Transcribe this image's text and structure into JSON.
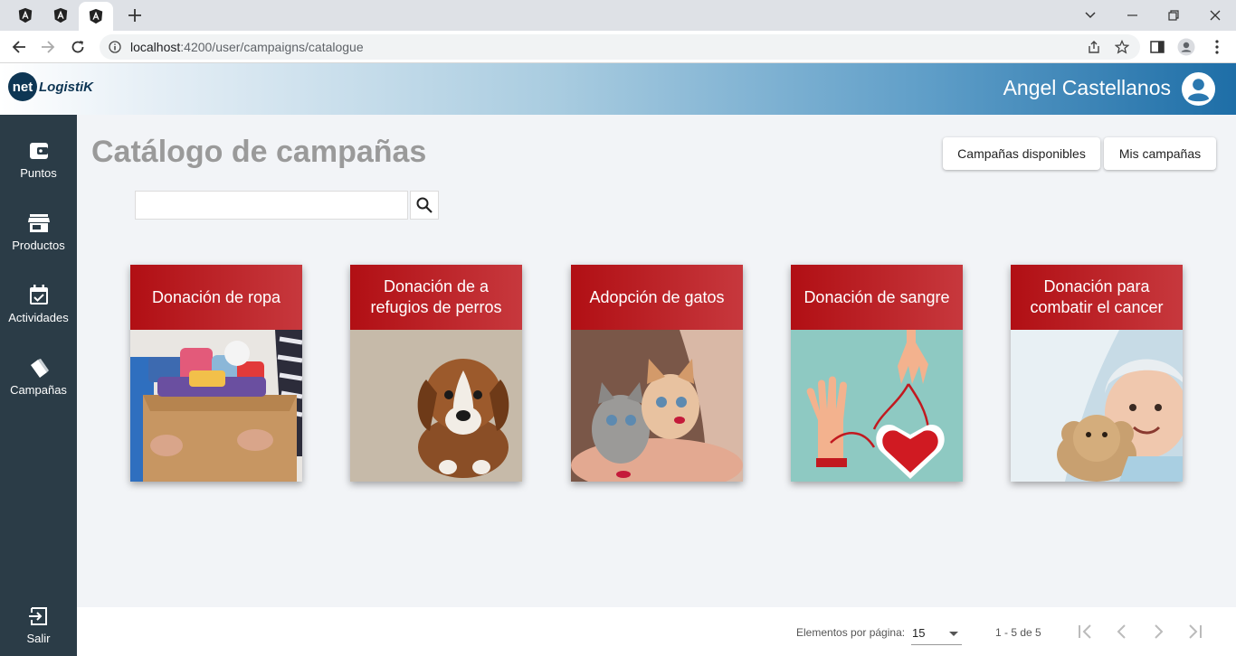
{
  "browser": {
    "url_host": "localhost",
    "url_path": ":4200/user/campaigns/catalogue"
  },
  "app": {
    "logo_badge": "net",
    "logo_text": "LogistiK",
    "user_name": "Angel Castellanos"
  },
  "sidebar": {
    "items": [
      {
        "label": "Puntos",
        "icon": "wallet-icon"
      },
      {
        "label": "Productos",
        "icon": "store-icon"
      },
      {
        "label": "Actividades",
        "icon": "calendar-check-icon"
      },
      {
        "label": "Campañas",
        "icon": "campaign-tag-icon"
      }
    ],
    "logout_label": "Salir"
  },
  "main": {
    "title": "Catálogo de campañas",
    "buttons": {
      "available": "Campañas disponibles",
      "mine": "Mis campañas"
    },
    "search": {
      "value": "",
      "placeholder": ""
    },
    "cards": [
      {
        "title": "Donación de ropa",
        "image": "clothes-box"
      },
      {
        "title": "Donación de a refugios de perros",
        "image": "puppy"
      },
      {
        "title": "Adopción de gatos",
        "image": "kittens"
      },
      {
        "title": "Donación de sangre",
        "image": "blood-heart"
      },
      {
        "title": "Donación para combatir el cancer",
        "image": "child-teddy"
      }
    ]
  },
  "paginator": {
    "items_per_page_label": "Elementos por página:",
    "items_per_page_value": "15",
    "range_label": "1 - 5 de 5"
  },
  "colors": {
    "sidebar": "#2b3c47",
    "card_header": "#b10f14",
    "header_dark": "#1e6ea7"
  }
}
